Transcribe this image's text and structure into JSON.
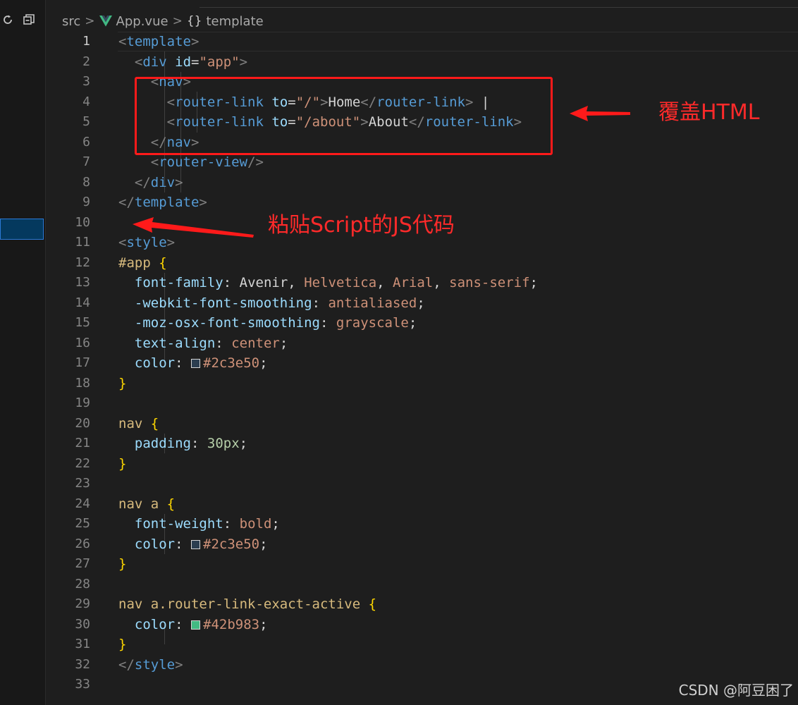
{
  "breadcrumb": {
    "items": [
      "src",
      "App.vue",
      "template"
    ],
    "braces": "{}",
    "separator": ">"
  },
  "icons": {
    "sidebar": [
      "refresh-icon",
      "collapse-all-icon"
    ],
    "vue_file": "vue-logo-icon"
  },
  "editor": {
    "active_line": 1,
    "line_numbers": [
      "1",
      "2",
      "3",
      "4",
      "5",
      "6",
      "7",
      "8",
      "9",
      "10",
      "11",
      "12",
      "13",
      "14",
      "15",
      "16",
      "17",
      "18",
      "19",
      "20",
      "21",
      "22",
      "23",
      "24",
      "25",
      "26",
      "27",
      "28",
      "29",
      "30",
      "31",
      "32",
      "33"
    ],
    "lines": {
      "l1": {
        "a": "<",
        "b": "template",
        "c": ">"
      },
      "l2": {
        "a": "<",
        "b": "div",
        "c": "id",
        "d": "=",
        "e": "\"app\"",
        "f": ">"
      },
      "l3": {
        "a": "<",
        "b": "nav",
        "c": ">"
      },
      "l4": {
        "a": "<",
        "b": "router-link",
        "c": "to",
        "d": "=",
        "e": "\"/\"",
        "f": ">",
        "g": "Home",
        "h": "</",
        "i": "router-link",
        "j": ">",
        "k": "|"
      },
      "l5": {
        "a": "<",
        "b": "router-link",
        "c": "to",
        "d": "=",
        "e": "\"/about\"",
        "f": ">",
        "g": "About",
        "h": "</",
        "i": "router-link",
        "j": ">"
      },
      "l6": {
        "a": "</",
        "b": "nav",
        "c": ">"
      },
      "l7": {
        "a": "<",
        "b": "router-view",
        "c": "/>"
      },
      "l8": {
        "a": "</",
        "b": "div",
        "c": ">"
      },
      "l9": {
        "a": "</",
        "b": "template",
        "c": ">"
      },
      "l11": {
        "a": "<",
        "b": "style",
        "c": ">"
      },
      "l12": {
        "sel": "#app",
        "brace": "{"
      },
      "l13": {
        "prop": "font-family",
        "colon": ":",
        "v1": "Avenir",
        "c1": ",",
        "v2": "Helvetica",
        "c2": ",",
        "v3": "Arial",
        "c3": ",",
        "v4": "sans-serif",
        "semi": ";"
      },
      "l14": {
        "prop": "-webkit-font-smoothing",
        "colon": ":",
        "val": "antialiased",
        "semi": ";"
      },
      "l15": {
        "prop": "-moz-osx-font-smoothing",
        "colon": ":",
        "val": "grayscale",
        "semi": ";"
      },
      "l16": {
        "prop": "text-align",
        "colon": ":",
        "val": "center",
        "semi": ";"
      },
      "l17": {
        "prop": "color",
        "colon": ":",
        "val": "#2c3e50",
        "semi": ";"
      },
      "l18": {
        "brace": "}"
      },
      "l20": {
        "sel": "nav",
        "brace": "{"
      },
      "l21": {
        "prop": "padding",
        "colon": ":",
        "val": "30px",
        "semi": ";"
      },
      "l22": {
        "brace": "}"
      },
      "l24": {
        "sel": "nav a",
        "brace": "{"
      },
      "l25": {
        "prop": "font-weight",
        "colon": ":",
        "val": "bold",
        "semi": ";"
      },
      "l26": {
        "prop": "color",
        "colon": ":",
        "val": "#2c3e50",
        "semi": ";"
      },
      "l27": {
        "brace": "}"
      },
      "l29": {
        "sel": "nav a.router-link-exact-active",
        "brace": "{"
      },
      "l30": {
        "prop": "color",
        "colon": ":",
        "val": "#42b983",
        "semi": ";"
      },
      "l31": {
        "brace": "}"
      },
      "l32": {
        "a": "</",
        "b": "style",
        "c": ">"
      }
    }
  },
  "annotations": {
    "box_label": "覆盖HTML",
    "arrow_label": "粘贴Script的JS代码",
    "color": "#ff2a2a"
  },
  "swatch_colors": {
    "dark": "#2c3e50",
    "green": "#42b983"
  },
  "watermark": "CSDN @阿豆困了"
}
